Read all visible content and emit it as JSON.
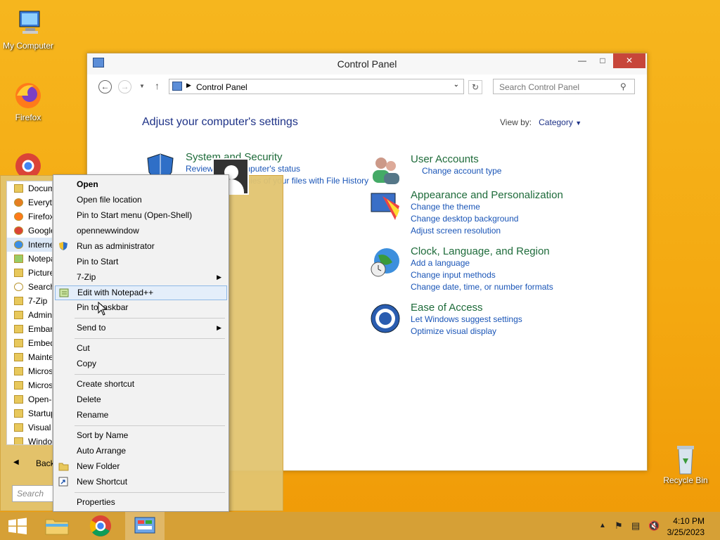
{
  "desktop": {
    "icons": [
      {
        "label": "My Computer"
      },
      {
        "label": "Firefox"
      },
      {
        "label": "Recycle Bin"
      }
    ]
  },
  "window": {
    "title": "Control Panel",
    "address": "Control Panel",
    "search_placeholder": "Search Control Panel",
    "heading": "Adjust your computer's settings",
    "view_by_label": "View by:",
    "view_by_value": "Category",
    "categories": [
      {
        "title": "System and Security",
        "links": [
          "Review your computer's status",
          "Save backup copies of your files with File History"
        ]
      },
      {
        "title": "User Accounts",
        "links": [
          "Change account type"
        ]
      },
      {
        "title": "Appearance and Personalization",
        "links": [
          "Change the theme",
          "Change desktop background",
          "Adjust screen resolution"
        ]
      },
      {
        "title": "Clock, Language, and Region",
        "links": [
          "Add a language",
          "Change input methods",
          "Change date, time, or number formats"
        ]
      },
      {
        "title": "Ease of Access",
        "links": [
          "Let Windows suggest settings",
          "Optimize visual display"
        ]
      }
    ]
  },
  "start_menu": {
    "items": [
      "Documents",
      "Everything",
      "Firefox",
      "Google Chrome",
      "Internet Explorer",
      "Notepad++",
      "Pictures",
      "Search",
      "7-Zip",
      "Administrative Tools",
      "Embarcadero",
      "Embedded",
      "Maintenance",
      "Microsoft",
      "Microsoft",
      "Open-Shell",
      "Startup",
      "Visual Studio",
      "Windows"
    ],
    "back_label": "Back",
    "search_placeholder": "Search programs and files"
  },
  "context_menu": {
    "items": [
      "Open",
      "Open file location",
      "Pin to Start menu (Open-Shell)",
      "opennewwindow",
      "Run as administrator",
      "Pin to Start",
      "7-Zip",
      "Edit with Notepad++",
      "Pin to taskbar",
      "Send to",
      "Cut",
      "Copy",
      "Create shortcut",
      "Delete",
      "Rename",
      "Sort by Name",
      "Auto Arrange",
      "New Folder",
      "New Shortcut",
      "Properties"
    ]
  },
  "taskbar": {
    "time": "4:10 PM",
    "date": "3/25/2023"
  }
}
